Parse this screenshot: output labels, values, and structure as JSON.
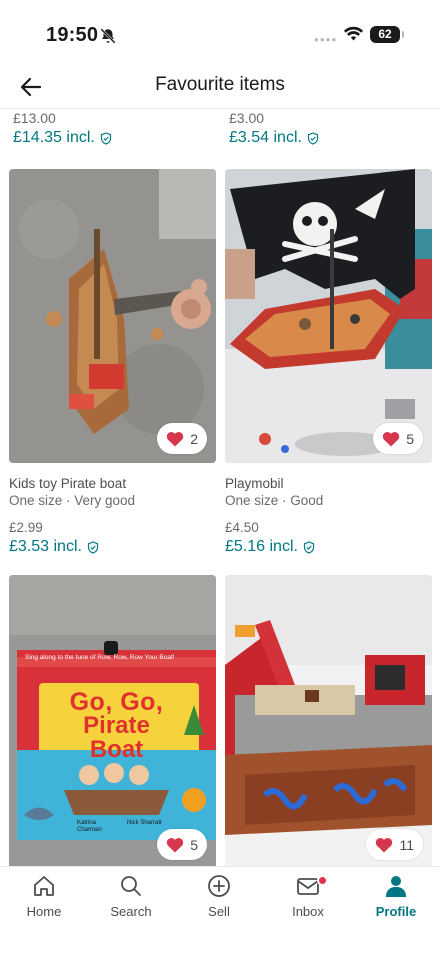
{
  "status_bar": {
    "time": "19:50",
    "battery": "62"
  },
  "header": {
    "title": "Favourite items"
  },
  "top_partial": [
    {
      "price": "£13.00",
      "price_incl": "£14.35 incl."
    },
    {
      "price": "£3.00",
      "price_incl": "£3.54 incl."
    }
  ],
  "items": [
    {
      "title": "Kids toy Pirate boat",
      "meta": "One size · Very good",
      "price": "£2.99",
      "price_incl": "£3.53 incl.",
      "favourites": "2"
    },
    {
      "title": "Playmobil",
      "meta": "One size · Good",
      "price": "£4.50",
      "price_incl": "£5.16 incl.",
      "favourites": "5"
    },
    {
      "favourites": "5",
      "book_banner": "Sing along to the tune of Row, Row, Row Your Boat!",
      "book_title_1": "Go, Go,",
      "book_title_2": "Pirate",
      "book_title_3": "Boat",
      "book_authors": "Katrina Charman",
      "book_illustrator": "Nick Sharratt"
    },
    {
      "favourites": "11"
    }
  ],
  "nav": {
    "items": [
      {
        "label": "Home",
        "icon": "home-icon"
      },
      {
        "label": "Search",
        "icon": "search-icon"
      },
      {
        "label": "Sell",
        "icon": "plus-circle-icon"
      },
      {
        "label": "Inbox",
        "icon": "mail-icon"
      },
      {
        "label": "Profile",
        "icon": "profile-icon"
      }
    ],
    "active": "Profile"
  },
  "colors": {
    "accent": "#007782",
    "heart": "#d6374f",
    "notification": "#e1334f"
  }
}
